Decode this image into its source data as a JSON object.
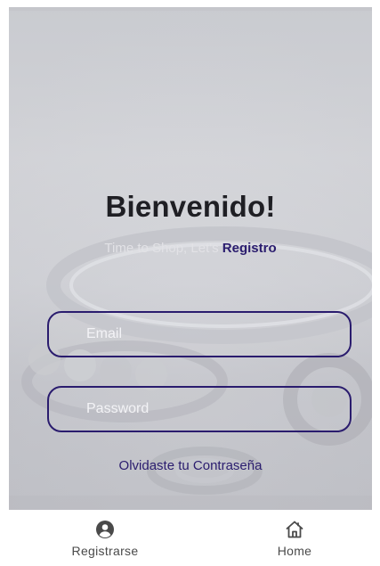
{
  "screen": {
    "title": "Bienvenido!",
    "subtitle_prefix": "Time to Shop, Let's ",
    "subtitle_link": "Registro"
  },
  "form": {
    "email_placeholder": "Email",
    "email_value": "",
    "password_placeholder": "Password",
    "password_value": "",
    "forgot_password": "Olvidaste tu Contraseña"
  },
  "bottom_nav": {
    "items": [
      {
        "label": "Registrarse",
        "icon": "account-circle-icon"
      },
      {
        "label": "Home",
        "icon": "home-icon"
      }
    ]
  },
  "colors": {
    "accent": "#2a1c6e",
    "title": "#1f1f24",
    "nav_text": "#4a4a4a"
  }
}
